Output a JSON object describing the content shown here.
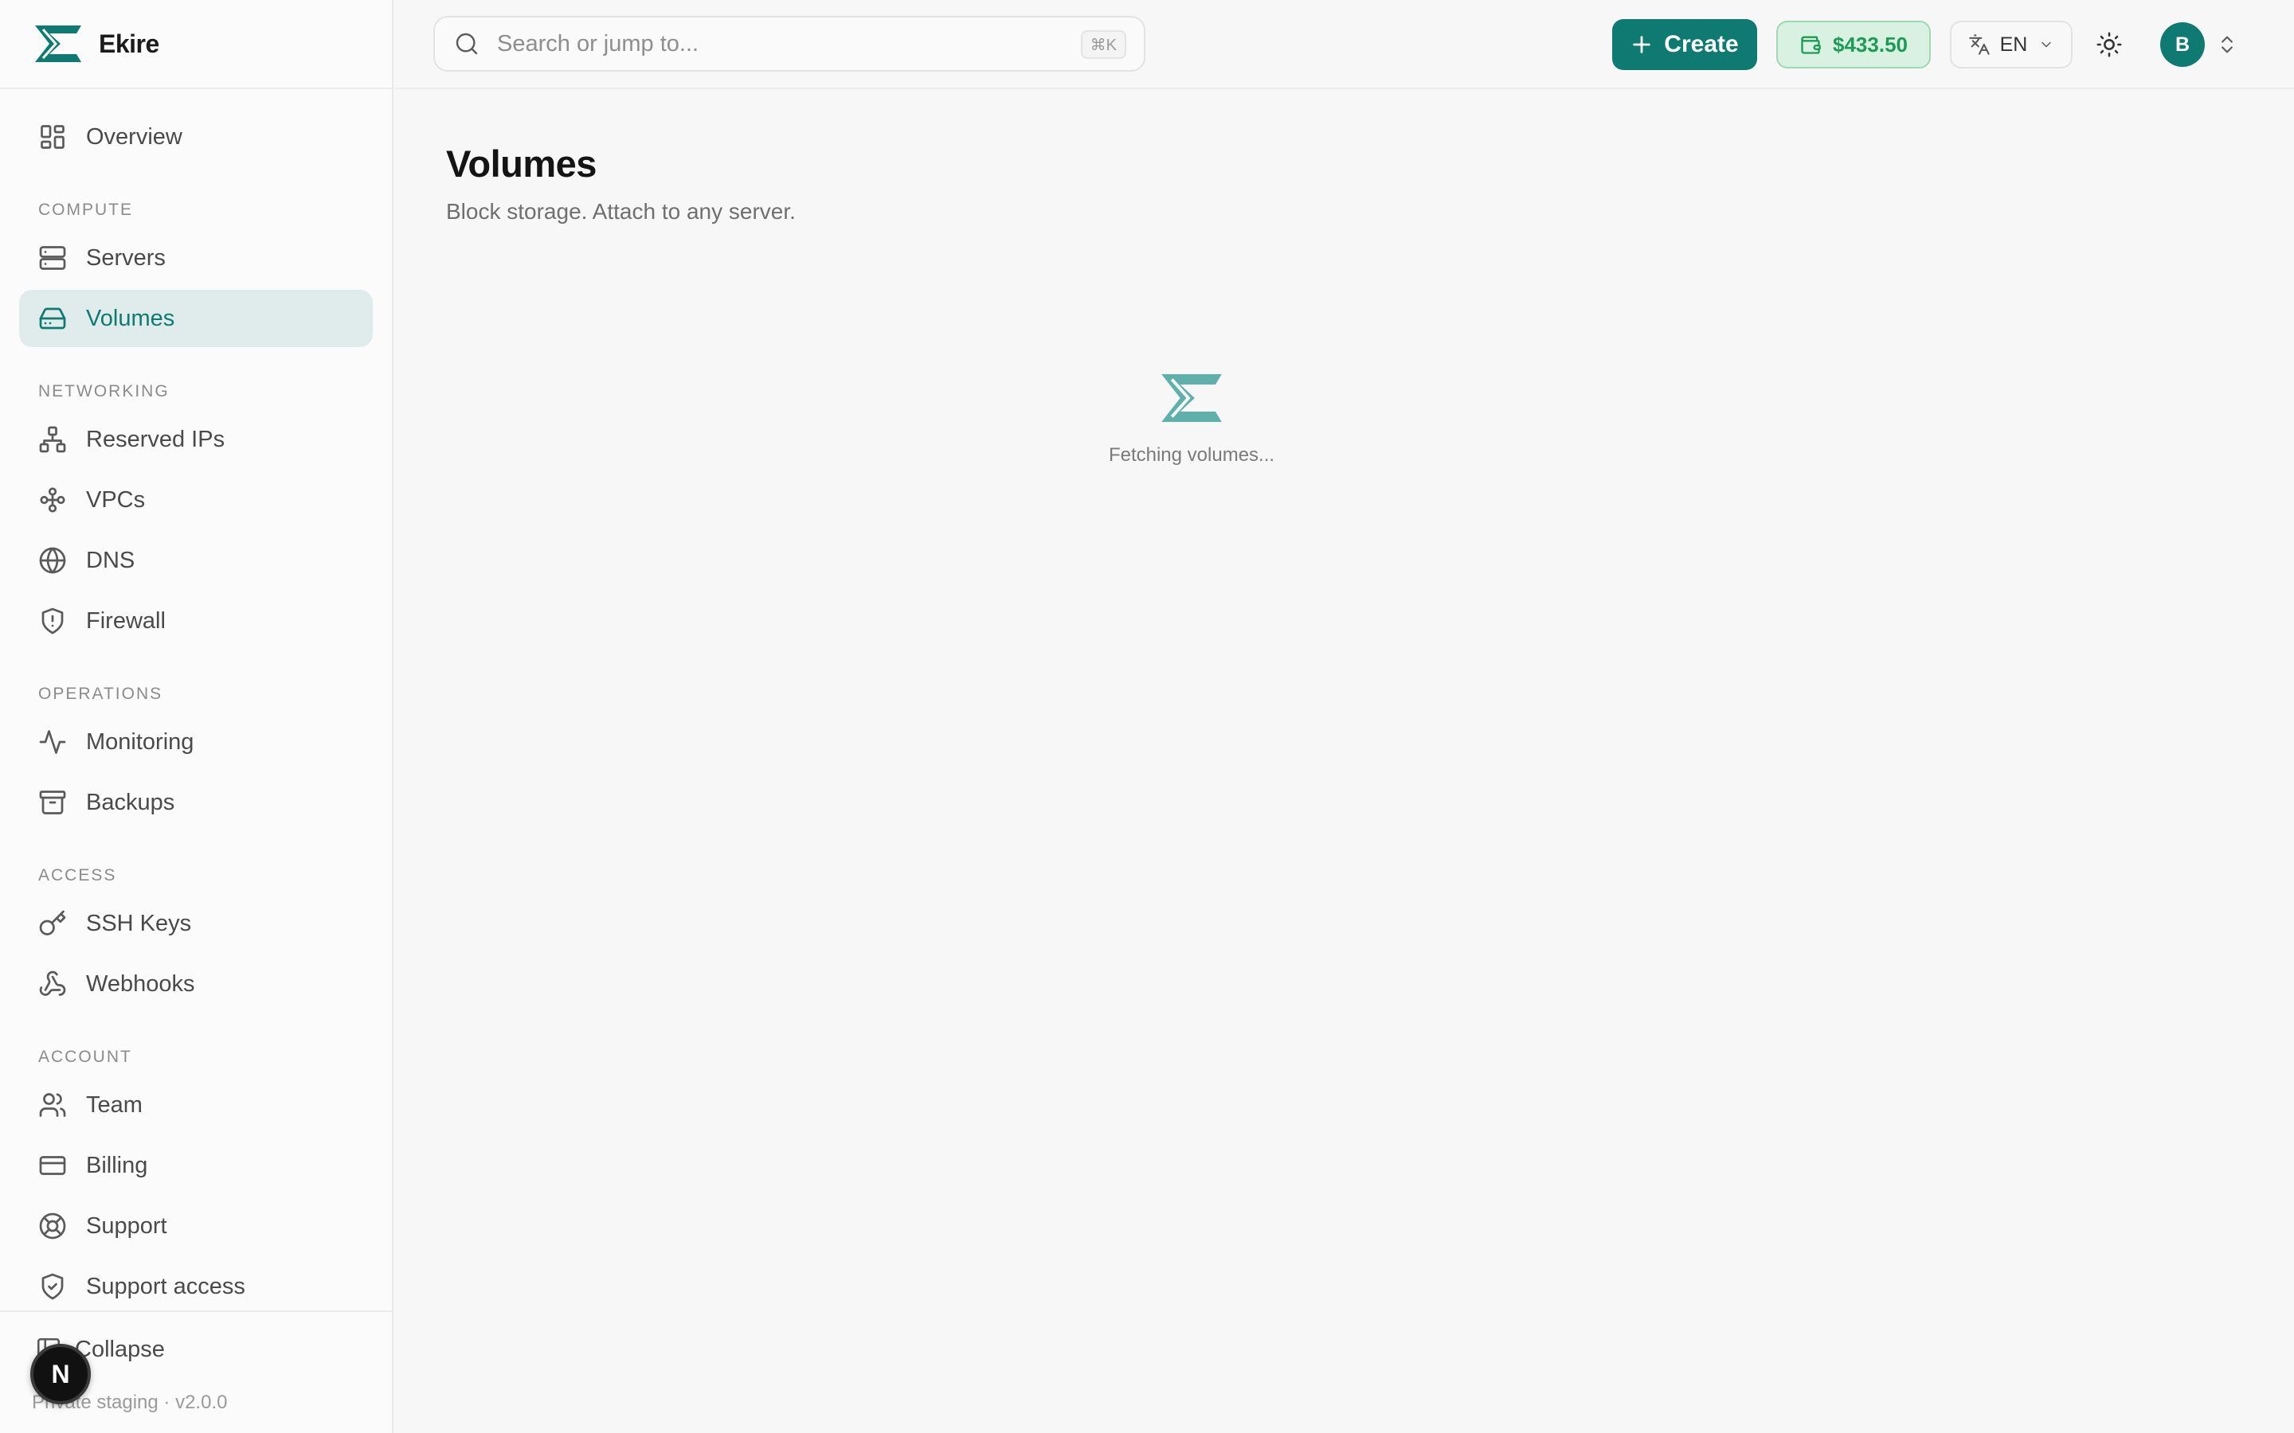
{
  "brand": {
    "name": "Ekire",
    "accent": "#0e7a72"
  },
  "sidebar": {
    "overview": {
      "label": "Overview",
      "icon": "grid-icon"
    },
    "sections": [
      {
        "label": "COMPUTE",
        "items": [
          {
            "label": "Servers",
            "icon": "server-icon",
            "active": false
          },
          {
            "label": "Volumes",
            "icon": "hard-drive-icon",
            "active": true
          }
        ]
      },
      {
        "label": "NETWORKING",
        "items": [
          {
            "label": "Reserved IPs",
            "icon": "network-icon",
            "active": false
          },
          {
            "label": "VPCs",
            "icon": "nodes-icon",
            "active": false
          },
          {
            "label": "DNS",
            "icon": "globe-icon",
            "active": false
          },
          {
            "label": "Firewall",
            "icon": "shield-alert-icon",
            "active": false
          }
        ]
      },
      {
        "label": "OPERATIONS",
        "items": [
          {
            "label": "Monitoring",
            "icon": "activity-icon",
            "active": false
          },
          {
            "label": "Backups",
            "icon": "archive-icon",
            "active": false
          }
        ]
      },
      {
        "label": "ACCESS",
        "items": [
          {
            "label": "SSH Keys",
            "icon": "key-icon",
            "active": false
          },
          {
            "label": "Webhooks",
            "icon": "webhook-icon",
            "active": false
          }
        ]
      },
      {
        "label": "ACCOUNT",
        "items": [
          {
            "label": "Team",
            "icon": "users-icon",
            "active": false
          },
          {
            "label": "Billing",
            "icon": "credit-card-icon",
            "active": false
          },
          {
            "label": "Support",
            "icon": "life-buoy-icon",
            "active": false
          },
          {
            "label": "Support access",
            "icon": "shield-check-icon",
            "active": false
          }
        ]
      }
    ],
    "footer": {
      "collapse_label": "Collapse",
      "version": "Private staging · v2.0.0",
      "dev_badge": "N"
    }
  },
  "topbar": {
    "search_placeholder": "Search or jump to...",
    "search_shortcut": "⌘K",
    "create_label": "Create",
    "balance": "$433.50",
    "language": "EN",
    "avatar_initial": "B"
  },
  "main": {
    "title": "Volumes",
    "subtitle": "Block storage. Attach to any server.",
    "loading_text": "Fetching volumes..."
  }
}
